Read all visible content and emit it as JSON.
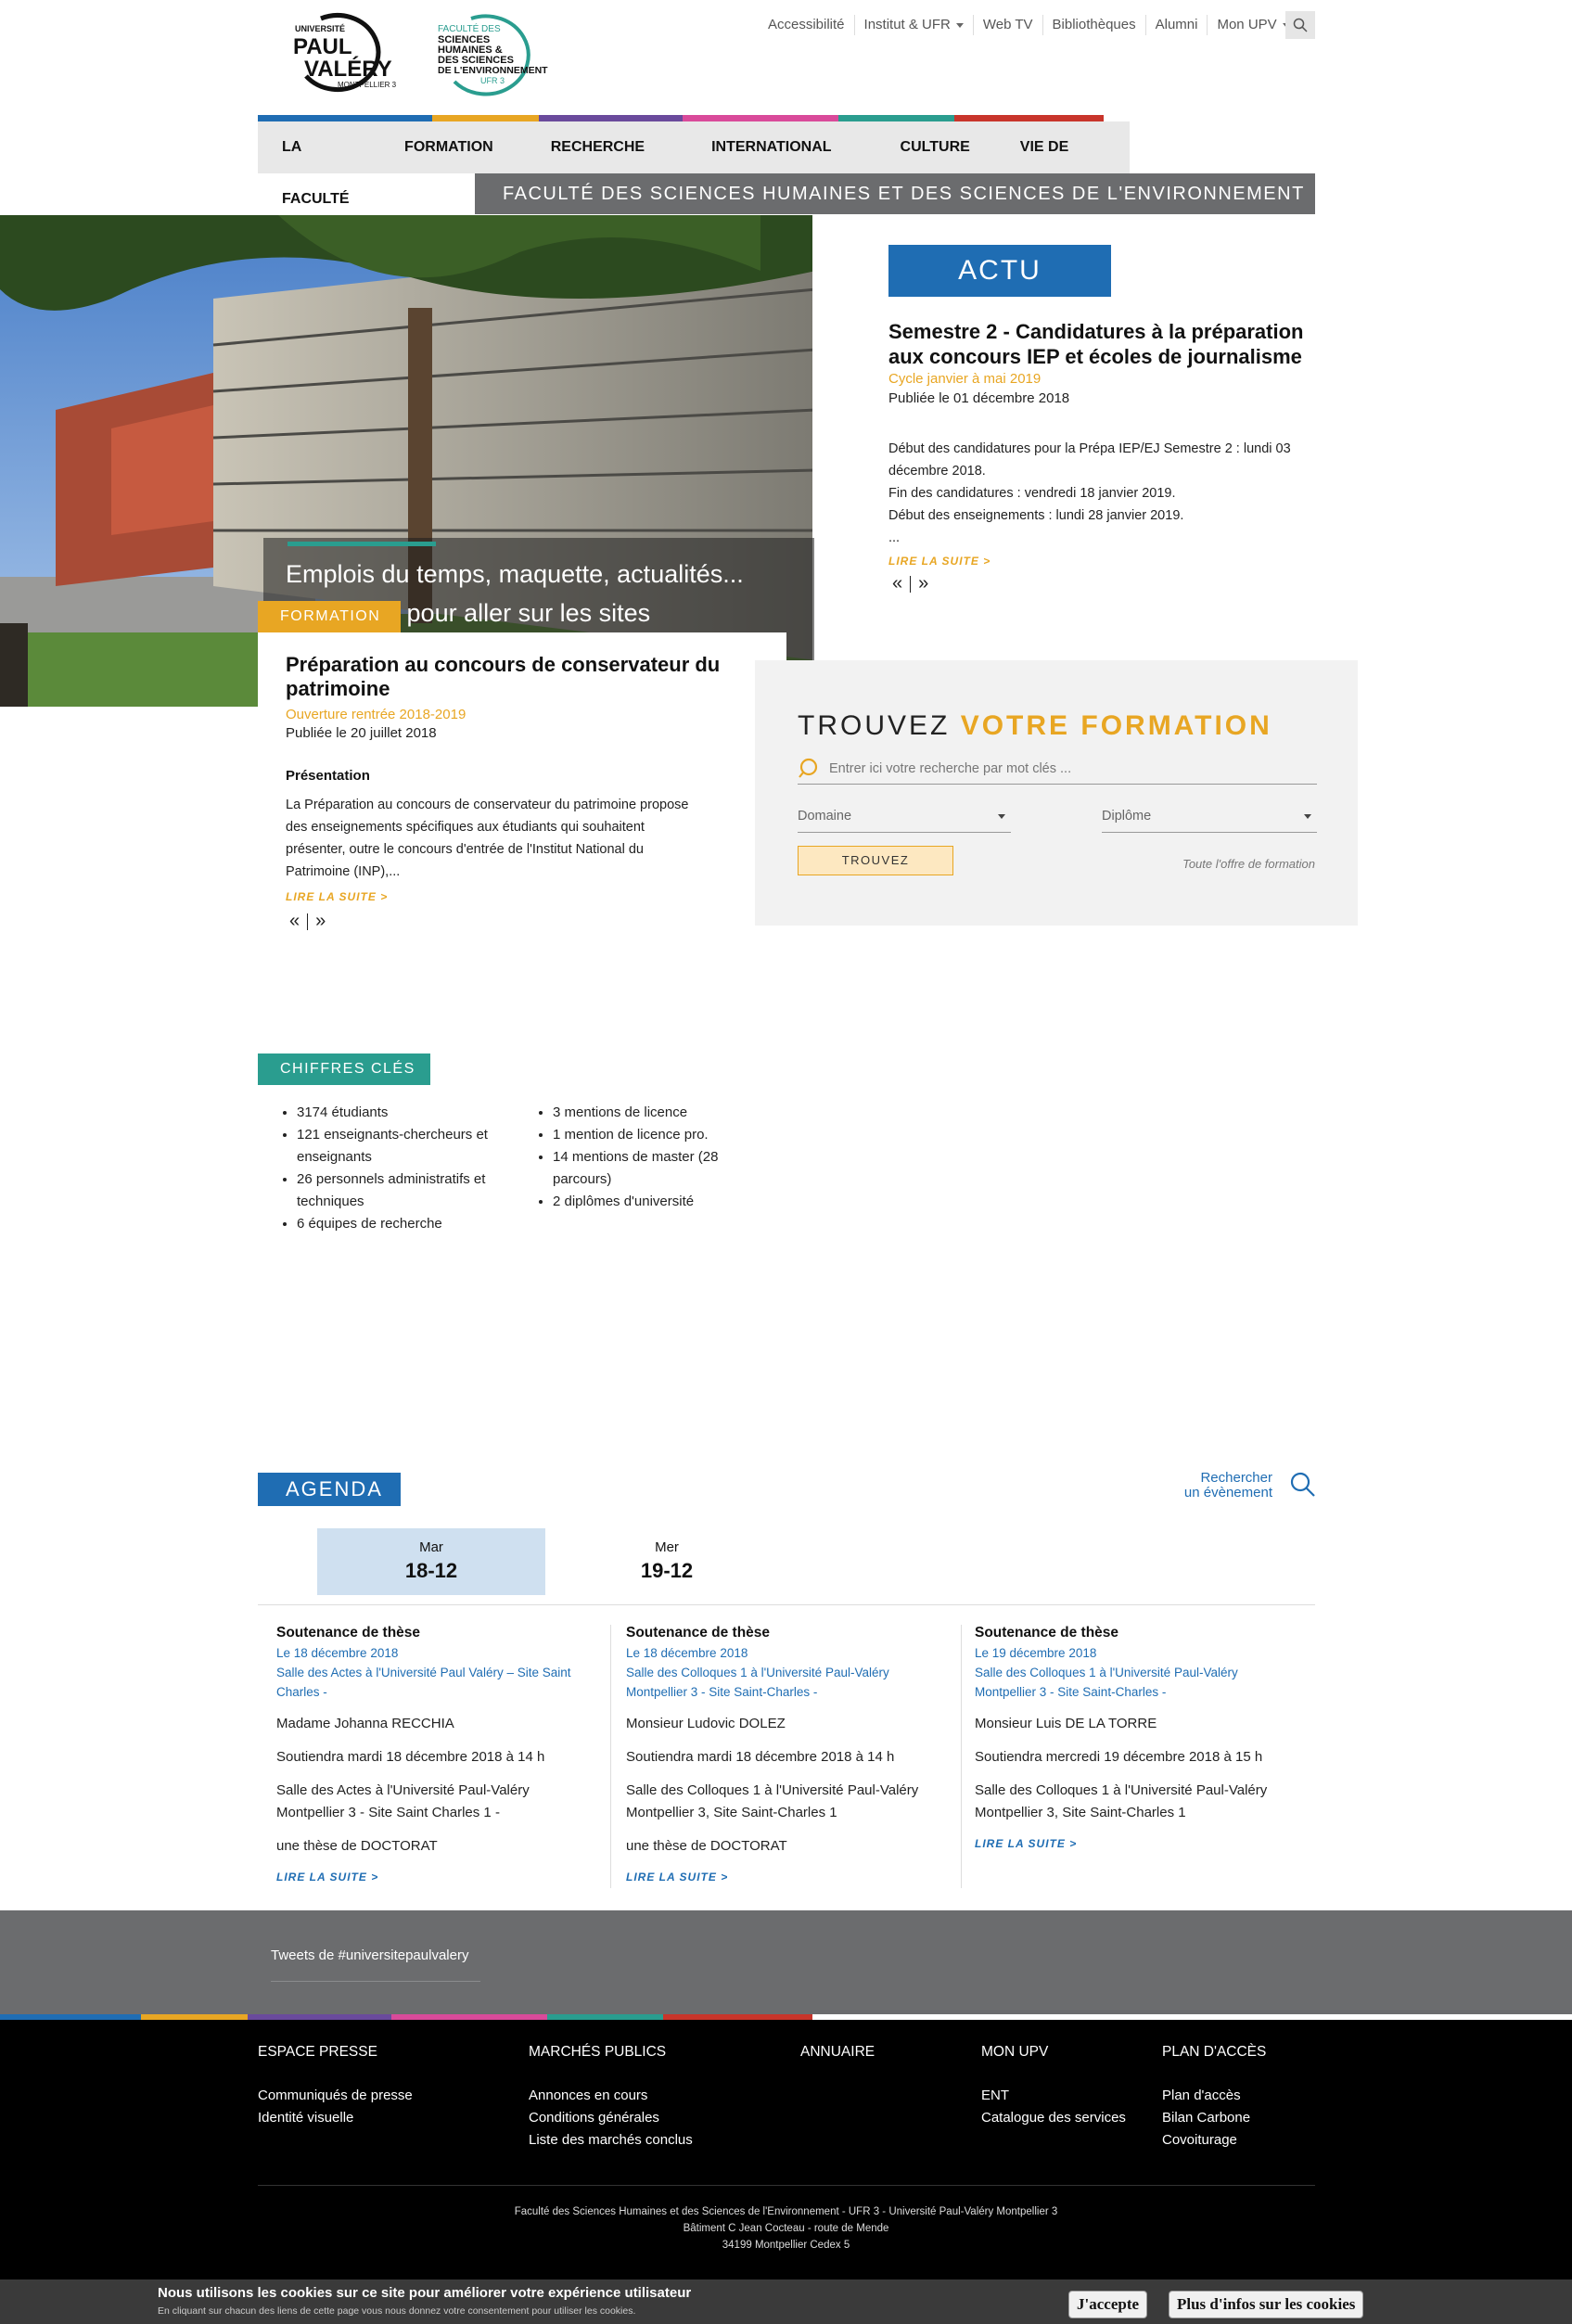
{
  "topnav": {
    "items": [
      {
        "label": "Accessibilité",
        "dropdown": false
      },
      {
        "label": "Institut & UFR",
        "dropdown": true
      },
      {
        "label": "Web TV",
        "dropdown": false
      },
      {
        "label": "Bibliothèques",
        "dropdown": false
      },
      {
        "label": "Alumni",
        "dropdown": false
      },
      {
        "label": "Mon UPV",
        "dropdown": true
      }
    ]
  },
  "logos": {
    "upv": {
      "line1": "UNIVERSITÉ",
      "line2": "PAUL",
      "line3": "VALÉRY",
      "line4": "MONTPELLIER 3"
    },
    "faculty": {
      "line1": "FACULTÉ DES",
      "line2": "SCIENCES",
      "line3": "HUMAINES &",
      "line4": "DES SCIENCES",
      "line5": "DE L'ENVIRONNEMENT",
      "line6": "UFR 3"
    }
  },
  "mainnav": {
    "items": [
      "LA FACULTÉ",
      "FORMATION",
      "RECHERCHE",
      "INTERNATIONAL",
      "CULTURE",
      "VIE DE CAMPUS"
    ]
  },
  "colors": {
    "blue": "#1f6db3",
    "orange": "#e8a623",
    "purple": "#6a4a9c",
    "pink": "#d94a9a",
    "teal": "#2a9d8f",
    "red": "#c8352b",
    "gray": "#6b6c6e"
  },
  "faculty_banner": "FACULTÉ DES SCIENCES HUMAINES ET DES SCIENCES DE L'ENVIRONNEMENT",
  "hero": {
    "text": "Emplois du temps, maquette, actualités... Cliquez ici pour aller sur les sites pédagogiques des formations"
  },
  "formation": {
    "tag": "FORMATION",
    "title": "Préparation au concours de conservateur du patrimoine",
    "subtitle": "Ouverture rentrée 2018-2019",
    "date": "Publiée le 20 juillet 2018",
    "section_heading": "Présentation",
    "body": "La Préparation au concours de conservateur du patrimoine propose des enseignements spécifiques aux étudiants qui souhaitent présenter, outre le concours d'entrée de l'Institut National du Patrimoine (INP),...",
    "read_more": "LIRE LA SUITE  >",
    "prev": "«",
    "next": "»"
  },
  "actu": {
    "tag": "ACTU",
    "title": "Semestre 2 - Candidatures à la préparation aux concours IEP et écoles de journalisme",
    "subtitle": "Cycle janvier à mai 2019",
    "date": "Publiée le 01 décembre 2018",
    "body_lines": [
      "Début des candidatures pour la Prépa IEP/EJ Semestre 2 :  lundi 03 décembre 2018.",
      "Fin des candidatures : vendredi 18 janvier 2019.",
      "Début des enseignements : lundi 28 janvier 2019.",
      "..."
    ],
    "read_more": "LIRE LA SUITE  >",
    "prev": "«",
    "next": "»"
  },
  "trouvez": {
    "title_plain": "TROUVEZ",
    "title_accent": "VOTRE FORMATION",
    "search_placeholder": "Entrer ici votre recherche par mot clés ...",
    "domaine": "Domaine",
    "diplome": "Diplôme",
    "button": "TROUVEZ",
    "all_link": "Toute l'offre de formation"
  },
  "chiffres": {
    "tag": "CHIFFRES CLÉS",
    "col1": [
      "3174 étudiants",
      "121 enseignants-chercheurs et enseignants",
      "26 personnels administratifs et techniques",
      "6 équipes de recherche"
    ],
    "col2": [
      "3 mentions de licence",
      "1 mention de licence pro.",
      "14 mentions de master (28 parcours)",
      "2 diplômes d'université"
    ]
  },
  "agenda": {
    "tag": "AGENDA",
    "search_line1": "Rechercher",
    "search_line2": "un évènement",
    "days": [
      {
        "weekday": "Mar",
        "date": "18-12",
        "active": true
      },
      {
        "weekday": "Mer",
        "date": "19-12",
        "active": false
      }
    ],
    "events": [
      {
        "title": "Soutenance de thèse",
        "date": "Le 18 décembre 2018",
        "place": "Salle des Actes à l'Université Paul Valéry – Site Saint Charles -",
        "p1": "Madame Johanna RECCHIA",
        "p2": "Soutiendra mardi 18 décembre 2018 à 14 h",
        "p3": "Salle des Actes à l'Université Paul-Valéry Montpellier 3  - Site Saint Charles 1 -",
        "p4": "une thèse de DOCTORAT",
        "more": "LIRE LA SUITE  >"
      },
      {
        "title": "Soutenance de thèse",
        "date": "Le 18 décembre 2018",
        "place": "Salle des Colloques 1 à l'Université Paul-Valéry Montpellier 3 - Site Saint-Charles -",
        "p1": "Monsieur Ludovic DOLEZ",
        "p2": "Soutiendra mardi 18 décembre 2018 à 14 h",
        "p3": "Salle des Colloques 1 à l'Université Paul-Valéry Montpellier 3, Site Saint-Charles 1",
        "p4": "une thèse de DOCTORAT",
        "more": "LIRE LA SUITE  >"
      },
      {
        "title": "Soutenance de thèse",
        "date": "Le 19 décembre 2018",
        "place": "Salle des Colloques 1 à l'Université Paul-Valéry Montpellier 3 - Site Saint-Charles -",
        "p1": "Monsieur Luis DE LA TORRE",
        "p2": "Soutiendra mercredi 19 décembre 2018 à 15 h",
        "p3": "Salle des Colloques 1 à l'Université Paul-Valéry Montpellier 3, Site Saint-Charles 1",
        "more": "LIRE LA SUITE  >"
      }
    ]
  },
  "tweets": {
    "label": "Tweets de #universitepaulvalery"
  },
  "footer": {
    "cols": [
      {
        "heading": "ESPACE PRESSE",
        "links": [
          "Communiqués de presse",
          "Identité visuelle"
        ]
      },
      {
        "heading": "MARCHÉS PUBLICS",
        "links": [
          "Annonces en cours",
          "Conditions générales",
          "Liste des marchés conclus"
        ]
      },
      {
        "heading": "ANNUAIRE",
        "links": []
      },
      {
        "heading": "MON UPV",
        "links": [
          "ENT",
          "Catalogue des services"
        ]
      },
      {
        "heading": "PLAN D'ACCÈS",
        "links": [
          "Plan d'accès",
          "Bilan Carbone",
          "Covoiturage"
        ]
      }
    ],
    "address": [
      "Faculté des Sciences Humaines et des Sciences de l'Environnement - UFR 3 - Université Paul-Valéry Montpellier 3",
      "Bâtiment C Jean Cocteau - route de Mende",
      "34199 Montpellier Cedex 5"
    ]
  },
  "cookie": {
    "title": "Nous utilisons les cookies sur ce site pour améliorer votre expérience utilisateur",
    "text": "En cliquant sur chacun des liens de cette page vous nous donnez votre consentement pour utiliser les cookies.",
    "accept": "J'accepte",
    "more": "Plus d'infos sur les cookies"
  }
}
